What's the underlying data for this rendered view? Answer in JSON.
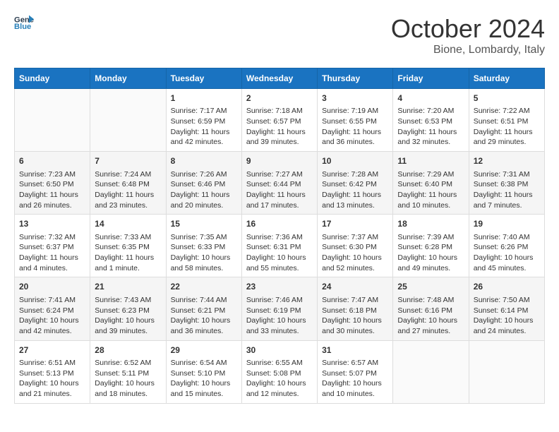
{
  "header": {
    "logo_line1": "General",
    "logo_line2": "Blue",
    "month_title": "October 2024",
    "location": "Bione, Lombardy, Italy"
  },
  "weekdays": [
    "Sunday",
    "Monday",
    "Tuesday",
    "Wednesday",
    "Thursday",
    "Friday",
    "Saturday"
  ],
  "weeks": [
    [
      {
        "day": "",
        "info": ""
      },
      {
        "day": "",
        "info": ""
      },
      {
        "day": "1",
        "info": "Sunrise: 7:17 AM\nSunset: 6:59 PM\nDaylight: 11 hours and 42 minutes."
      },
      {
        "day": "2",
        "info": "Sunrise: 7:18 AM\nSunset: 6:57 PM\nDaylight: 11 hours and 39 minutes."
      },
      {
        "day": "3",
        "info": "Sunrise: 7:19 AM\nSunset: 6:55 PM\nDaylight: 11 hours and 36 minutes."
      },
      {
        "day": "4",
        "info": "Sunrise: 7:20 AM\nSunset: 6:53 PM\nDaylight: 11 hours and 32 minutes."
      },
      {
        "day": "5",
        "info": "Sunrise: 7:22 AM\nSunset: 6:51 PM\nDaylight: 11 hours and 29 minutes."
      }
    ],
    [
      {
        "day": "6",
        "info": "Sunrise: 7:23 AM\nSunset: 6:50 PM\nDaylight: 11 hours and 26 minutes."
      },
      {
        "day": "7",
        "info": "Sunrise: 7:24 AM\nSunset: 6:48 PM\nDaylight: 11 hours and 23 minutes."
      },
      {
        "day": "8",
        "info": "Sunrise: 7:26 AM\nSunset: 6:46 PM\nDaylight: 11 hours and 20 minutes."
      },
      {
        "day": "9",
        "info": "Sunrise: 7:27 AM\nSunset: 6:44 PM\nDaylight: 11 hours and 17 minutes."
      },
      {
        "day": "10",
        "info": "Sunrise: 7:28 AM\nSunset: 6:42 PM\nDaylight: 11 hours and 13 minutes."
      },
      {
        "day": "11",
        "info": "Sunrise: 7:29 AM\nSunset: 6:40 PM\nDaylight: 11 hours and 10 minutes."
      },
      {
        "day": "12",
        "info": "Sunrise: 7:31 AM\nSunset: 6:38 PM\nDaylight: 11 hours and 7 minutes."
      }
    ],
    [
      {
        "day": "13",
        "info": "Sunrise: 7:32 AM\nSunset: 6:37 PM\nDaylight: 11 hours and 4 minutes."
      },
      {
        "day": "14",
        "info": "Sunrise: 7:33 AM\nSunset: 6:35 PM\nDaylight: 11 hours and 1 minute."
      },
      {
        "day": "15",
        "info": "Sunrise: 7:35 AM\nSunset: 6:33 PM\nDaylight: 10 hours and 58 minutes."
      },
      {
        "day": "16",
        "info": "Sunrise: 7:36 AM\nSunset: 6:31 PM\nDaylight: 10 hours and 55 minutes."
      },
      {
        "day": "17",
        "info": "Sunrise: 7:37 AM\nSunset: 6:30 PM\nDaylight: 10 hours and 52 minutes."
      },
      {
        "day": "18",
        "info": "Sunrise: 7:39 AM\nSunset: 6:28 PM\nDaylight: 10 hours and 49 minutes."
      },
      {
        "day": "19",
        "info": "Sunrise: 7:40 AM\nSunset: 6:26 PM\nDaylight: 10 hours and 45 minutes."
      }
    ],
    [
      {
        "day": "20",
        "info": "Sunrise: 7:41 AM\nSunset: 6:24 PM\nDaylight: 10 hours and 42 minutes."
      },
      {
        "day": "21",
        "info": "Sunrise: 7:43 AM\nSunset: 6:23 PM\nDaylight: 10 hours and 39 minutes."
      },
      {
        "day": "22",
        "info": "Sunrise: 7:44 AM\nSunset: 6:21 PM\nDaylight: 10 hours and 36 minutes."
      },
      {
        "day": "23",
        "info": "Sunrise: 7:46 AM\nSunset: 6:19 PM\nDaylight: 10 hours and 33 minutes."
      },
      {
        "day": "24",
        "info": "Sunrise: 7:47 AM\nSunset: 6:18 PM\nDaylight: 10 hours and 30 minutes."
      },
      {
        "day": "25",
        "info": "Sunrise: 7:48 AM\nSunset: 6:16 PM\nDaylight: 10 hours and 27 minutes."
      },
      {
        "day": "26",
        "info": "Sunrise: 7:50 AM\nSunset: 6:14 PM\nDaylight: 10 hours and 24 minutes."
      }
    ],
    [
      {
        "day": "27",
        "info": "Sunrise: 6:51 AM\nSunset: 5:13 PM\nDaylight: 10 hours and 21 minutes."
      },
      {
        "day": "28",
        "info": "Sunrise: 6:52 AM\nSunset: 5:11 PM\nDaylight: 10 hours and 18 minutes."
      },
      {
        "day": "29",
        "info": "Sunrise: 6:54 AM\nSunset: 5:10 PM\nDaylight: 10 hours and 15 minutes."
      },
      {
        "day": "30",
        "info": "Sunrise: 6:55 AM\nSunset: 5:08 PM\nDaylight: 10 hours and 12 minutes."
      },
      {
        "day": "31",
        "info": "Sunrise: 6:57 AM\nSunset: 5:07 PM\nDaylight: 10 hours and 10 minutes."
      },
      {
        "day": "",
        "info": ""
      },
      {
        "day": "",
        "info": ""
      }
    ]
  ]
}
